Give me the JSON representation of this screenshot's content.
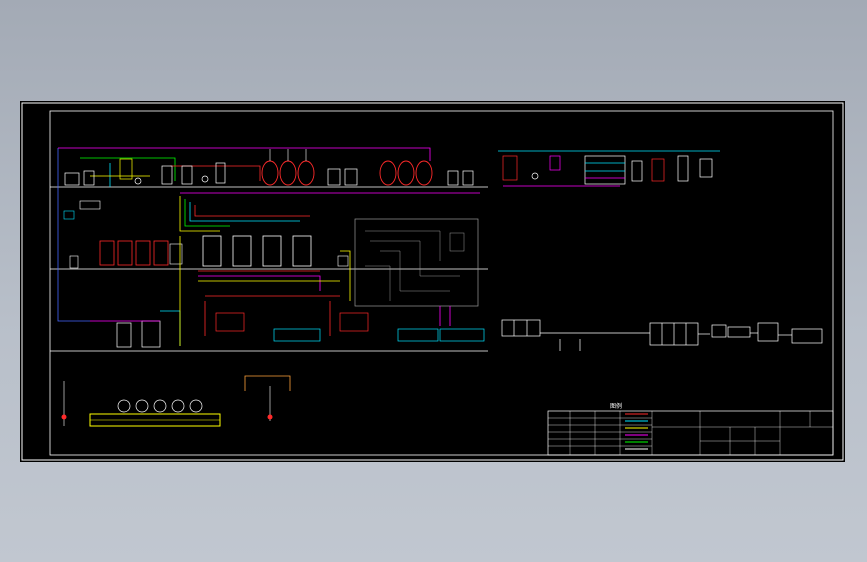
{
  "drawing": {
    "colors": {
      "background": "#000000",
      "frame": "#ffffff",
      "steam": "#ff2a2a",
      "water": "#00e5ff",
      "product": "#ffff00",
      "cip": "#ff00ff",
      "air": "#00ff00",
      "vacuum": "#ffffff",
      "blue_line": "#4466ff",
      "gray_box": "#9a9a9a"
    },
    "icons": [
      "tank-icon",
      "pump-icon",
      "valve-icon",
      "heat-exchanger-icon"
    ],
    "legend": {
      "title": "图例",
      "rows": 6
    }
  }
}
